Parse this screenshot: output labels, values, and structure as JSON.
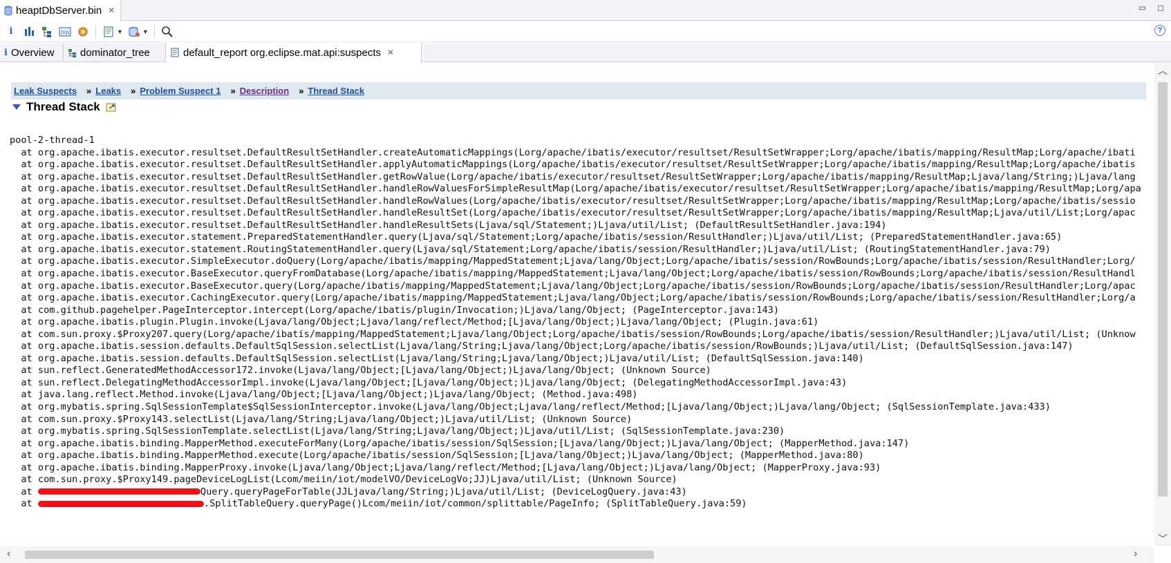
{
  "editor_tab": {
    "title": "heaptDbServer.bin",
    "close": "✕"
  },
  "inner_tabs": [
    {
      "label": "Overview"
    },
    {
      "label": "dominator_tree"
    },
    {
      "label": "default_report  org.eclipse.mat.api:suspects",
      "close": "✕"
    }
  ],
  "breadcrumb": {
    "items": [
      "Leak Suspects",
      "Leaks",
      "Problem Suspect 1",
      "Description",
      "Thread Stack"
    ],
    "separator": "»"
  },
  "section_title": "Thread Stack",
  "stack_lines": [
    "pool-2-thread-1",
    "  at org.apache.ibatis.executor.resultset.DefaultResultSetHandler.createAutomaticMappings(Lorg/apache/ibatis/executor/resultset/ResultSetWrapper;Lorg/apache/ibatis/mapping/ResultMap;Lorg/apache/ibati",
    "  at org.apache.ibatis.executor.resultset.DefaultResultSetHandler.applyAutomaticMappings(Lorg/apache/ibatis/executor/resultset/ResultSetWrapper;Lorg/apache/ibatis/mapping/ResultMap;Lorg/apache/ibatis",
    "  at org.apache.ibatis.executor.resultset.DefaultResultSetHandler.getRowValue(Lorg/apache/ibatis/executor/resultset/ResultSetWrapper;Lorg/apache/ibatis/mapping/ResultMap;Ljava/lang/String;)Ljava/lang",
    "  at org.apache.ibatis.executor.resultset.DefaultResultSetHandler.handleRowValuesForSimpleResultMap(Lorg/apache/ibatis/executor/resultset/ResultSetWrapper;Lorg/apache/ibatis/mapping/ResultMap;Lorg/apa",
    "  at org.apache.ibatis.executor.resultset.DefaultResultSetHandler.handleRowValues(Lorg/apache/ibatis/executor/resultset/ResultSetWrapper;Lorg/apache/ibatis/mapping/ResultMap;Lorg/apache/ibatis/sessio",
    "  at org.apache.ibatis.executor.resultset.DefaultResultSetHandler.handleResultSet(Lorg/apache/ibatis/executor/resultset/ResultSetWrapper;Lorg/apache/ibatis/mapping/ResultMap;Ljava/util/List;Lorg/apac",
    "  at org.apache.ibatis.executor.resultset.DefaultResultSetHandler.handleResultSets(Ljava/sql/Statement;)Ljava/util/List; (DefaultResultSetHandler.java:194)",
    "  at org.apache.ibatis.executor.statement.PreparedStatementHandler.query(Ljava/sql/Statement;Lorg/apache/ibatis/session/ResultHandler;)Ljava/util/List; (PreparedStatementHandler.java:65)",
    "  at org.apache.ibatis.executor.statement.RoutingStatementHandler.query(Ljava/sql/Statement;Lorg/apache/ibatis/session/ResultHandler;)Ljava/util/List; (RoutingStatementHandler.java:79)",
    "  at org.apache.ibatis.executor.SimpleExecutor.doQuery(Lorg/apache/ibatis/mapping/MappedStatement;Ljava/lang/Object;Lorg/apache/ibatis/session/RowBounds;Lorg/apache/ibatis/session/ResultHandler;Lorg/",
    "  at org.apache.ibatis.executor.BaseExecutor.queryFromDatabase(Lorg/apache/ibatis/mapping/MappedStatement;Ljava/lang/Object;Lorg/apache/ibatis/session/RowBounds;Lorg/apache/ibatis/session/ResultHandl",
    "  at org.apache.ibatis.executor.BaseExecutor.query(Lorg/apache/ibatis/mapping/MappedStatement;Ljava/lang/Object;Lorg/apache/ibatis/session/RowBounds;Lorg/apache/ibatis/session/ResultHandler;Lorg/apac",
    "  at org.apache.ibatis.executor.CachingExecutor.query(Lorg/apache/ibatis/mapping/MappedStatement;Ljava/lang/Object;Lorg/apache/ibatis/session/RowBounds;Lorg/apache/ibatis/session/ResultHandler;Lorg/a",
    "  at com.github.pagehelper.PageInterceptor.intercept(Lorg/apache/ibatis/plugin/Invocation;)Ljava/lang/Object; (PageInterceptor.java:143)",
    "  at org.apache.ibatis.plugin.Plugin.invoke(Ljava/lang/Object;Ljava/lang/reflect/Method;[Ljava/lang/Object;)Ljava/lang/Object; (Plugin.java:61)",
    "  at com.sun.proxy.$Proxy207.query(Lorg/apache/ibatis/mapping/MappedStatement;Ljava/lang/Object;Lorg/apache/ibatis/session/RowBounds;Lorg/apache/ibatis/session/ResultHandler;)Ljava/util/List; (Unknow",
    "  at org.apache.ibatis.session.defaults.DefaultSqlSession.selectList(Ljava/lang/String;Ljava/lang/Object;Lorg/apache/ibatis/session/RowBounds;)Ljava/util/List; (DefaultSqlSession.java:147)",
    "  at org.apache.ibatis.session.defaults.DefaultSqlSession.selectList(Ljava/lang/String;Ljava/lang/Object;)Ljava/util/List; (DefaultSqlSession.java:140)",
    "  at sun.reflect.GeneratedMethodAccessor172.invoke(Ljava/lang/Object;[Ljava/lang/Object;)Ljava/lang/Object; (Unknown Source)",
    "  at sun.reflect.DelegatingMethodAccessorImpl.invoke(Ljava/lang/Object;[Ljava/lang/Object;)Ljava/lang/Object; (DelegatingMethodAccessorImpl.java:43)",
    "  at java.lang.reflect.Method.invoke(Ljava/lang/Object;[Ljava/lang/Object;)Ljava/lang/Object; (Method.java:498)",
    "  at org.mybatis.spring.SqlSessionTemplate$SqlSessionInterceptor.invoke(Ljava/lang/Object;Ljava/lang/reflect/Method;[Ljava/lang/Object;)Ljava/lang/Object; (SqlSessionTemplate.java:433)",
    "  at com.sun.proxy.$Proxy143.selectList(Ljava/lang/String;Ljava/lang/Object;)Ljava/util/List; (Unknown Source)",
    "  at org.mybatis.spring.SqlSessionTemplate.selectList(Ljava/lang/String;Ljava/lang/Object;)Ljava/util/List; (SqlSessionTemplate.java:230)",
    "  at org.apache.ibatis.binding.MapperMethod.executeForMany(Lorg/apache/ibatis/session/SqlSession;[Ljava/lang/Object;)Ljava/lang/Object; (MapperMethod.java:147)",
    "  at org.apache.ibatis.binding.MapperMethod.execute(Lorg/apache/ibatis/session/SqlSession;[Ljava/lang/Object;)Ljava/lang/Object; (MapperMethod.java:80)",
    "  at org.apache.ibatis.binding.MapperProxy.invoke(Ljava/lang/Object;Ljava/lang/reflect/Method;[Ljava/lang/Object;)Ljava/lang/Object; (MapperProxy.java:93)",
    "  at com.sun.proxy.$Proxy149.pageDeviceLogList(Lcom/meiin/iot/modelVO/DeviceLogVo;JJ)Ljava/util/List; (Unknown Source)"
  ],
  "redacted_lines": [
    {
      "prefix": "  at ",
      "suffix": "Query.queryPageForTable(JJLjava/lang/String;)Ljava/util/List; (DeviceLogQuery.java:43)"
    },
    {
      "prefix": "  at ",
      "suffix": ".SplitTableQuery.queryPage()Lcom/meiin/iot/common/splittable/PageInfo; (SplitTableQuery.java:59)"
    }
  ]
}
